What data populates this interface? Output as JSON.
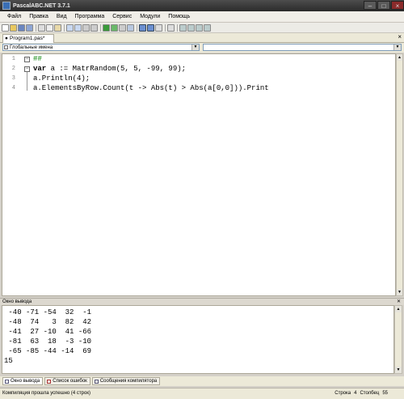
{
  "window": {
    "title": "PascalABC.NET 3.7.1"
  },
  "menu": [
    "Файл",
    "Правка",
    "Вид",
    "Программа",
    "Сервис",
    "Модули",
    "Помощь"
  ],
  "toolbar": {
    "icons": [
      "new-file-icon",
      "open-icon",
      "save-icon",
      "save-all-icon",
      "cut-icon",
      "copy-icon",
      "paste-icon",
      "undo-icon",
      "redo-icon",
      "find-icon",
      "replace-icon",
      "run-icon",
      "debug-icon",
      "stop-icon",
      "step-into-icon",
      "step-over-icon",
      "layout-1-icon",
      "layout-2-icon",
      "format-icon",
      "options-icon",
      "window-1-icon",
      "window-2-icon",
      "window-3-icon",
      "window-4-icon"
    ]
  },
  "tab": {
    "label": "Program1.pas*",
    "close": "×"
  },
  "combos": {
    "left": "Глобальные имена",
    "right": ""
  },
  "code": {
    "line_numbers": [
      "1",
      "2",
      "3",
      "4"
    ],
    "lines": [
      {
        "parts": [
          {
            "t": "##",
            "c": "cm"
          }
        ]
      },
      {
        "parts": [
          {
            "t": "var",
            "c": "kw"
          },
          {
            "t": " a := MatrRandom(5, 5, -99, 99);",
            "c": ""
          }
        ]
      },
      {
        "parts": [
          {
            "t": "a.Println(4);",
            "c": ""
          }
        ]
      },
      {
        "parts": [
          {
            "t": "a.ElementsByRow.Count(t -> Abs(t) > Abs(a[0,0])).Print",
            "c": ""
          }
        ]
      }
    ]
  },
  "output": {
    "title": "Окно вывода",
    "lines": [
      " -40 -71 -54  32  -1",
      " -48  74   3  82  42",
      " -41  27 -10  41 -66",
      " -81  63  18  -3 -10",
      " -65 -85 -44 -14  69",
      "15"
    ]
  },
  "bottom_tabs": [
    "Окно вывода",
    "Список ошибок",
    "Сообщения компилятора"
  ],
  "status": {
    "message": "Компиляция прошла успешно (4 строк)",
    "row_label": "Строка",
    "row": "4",
    "col_label": "Столбец",
    "col": "55"
  }
}
